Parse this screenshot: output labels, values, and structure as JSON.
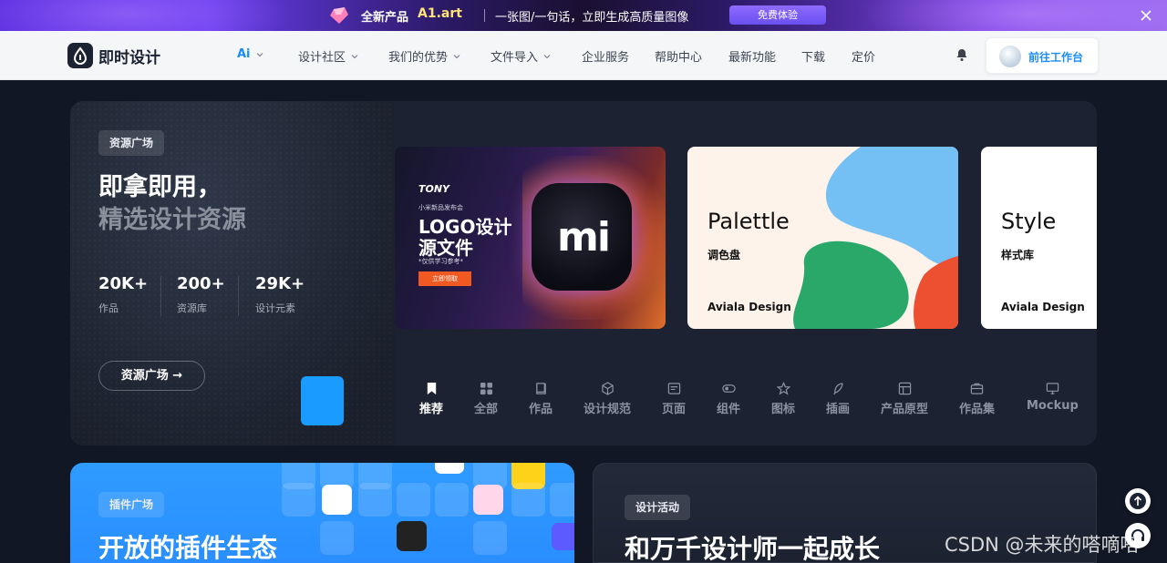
{
  "promo": {
    "badge": "全新产品",
    "brand": "A1.art",
    "text": "一张图/一句话，立即生成高质量图像",
    "cta": "免费体验"
  },
  "nav": {
    "logo": "即时设计",
    "items": [
      {
        "label": "Ai",
        "dropdown": true
      },
      {
        "label": "设计社区",
        "dropdown": true
      },
      {
        "label": "我们的优势",
        "dropdown": true
      },
      {
        "label": "文件导入",
        "dropdown": true
      },
      {
        "label": "企业服务",
        "dropdown": false
      },
      {
        "label": "帮助中心",
        "dropdown": false
      },
      {
        "label": "最新功能",
        "dropdown": false
      },
      {
        "label": "下载",
        "dropdown": false
      },
      {
        "label": "定价",
        "dropdown": false
      }
    ],
    "workspace": "前往工作台"
  },
  "hero": {
    "tag": "资源广场",
    "title_line1": "即拿即用，",
    "title_line2": "精选设计资源",
    "stats": [
      {
        "num": "20K+",
        "label": "作品"
      },
      {
        "num": "200+",
        "label": "资源库"
      },
      {
        "num": "29K+",
        "label": "设计元素"
      }
    ],
    "button": "资源广场 →",
    "cards": {
      "mi": {
        "brand": "TONY",
        "sub": "小米新品发布会",
        "title1": "LOGO设计",
        "title2": "源文件",
        "note": "*仅供学习参考*",
        "btn": "立即领取",
        "logo": "mi"
      },
      "palette": {
        "title": "Palettle",
        "sub": "调色盘",
        "foot": "Aviala Design"
      },
      "style": {
        "title": "Style",
        "sub": "样式库",
        "foot": "Aviala Design"
      }
    },
    "categories": [
      {
        "label": "推荐",
        "icon": "bookmark-icon",
        "active": true
      },
      {
        "label": "全部",
        "icon": "grid-icon",
        "active": false
      },
      {
        "label": "作品",
        "icon": "book-icon",
        "active": false
      },
      {
        "label": "设计规范",
        "icon": "cube-icon",
        "active": false
      },
      {
        "label": "页面",
        "icon": "page-icon",
        "active": false
      },
      {
        "label": "组件",
        "icon": "toggle-icon",
        "active": false
      },
      {
        "label": "图标",
        "icon": "star-icon",
        "active": false
      },
      {
        "label": "插画",
        "icon": "feather-icon",
        "active": false
      },
      {
        "label": "产品原型",
        "icon": "layout-icon",
        "active": false
      },
      {
        "label": "作品集",
        "icon": "briefcase-icon",
        "active": false
      },
      {
        "label": "Mockup",
        "icon": "monitor-icon",
        "active": false
      }
    ]
  },
  "plugins": {
    "tag": "插件广场",
    "title": "开放的插件生态"
  },
  "activity": {
    "tag": "设计活动",
    "title": "和万千设计师一起成长"
  },
  "watermark": "CSDN @未来的嗒嘀嗒",
  "colors": {
    "accent": "#1a8cff",
    "bg": "#111724",
    "card": "#1c2231",
    "plugin_blue": "#2f9bff"
  }
}
